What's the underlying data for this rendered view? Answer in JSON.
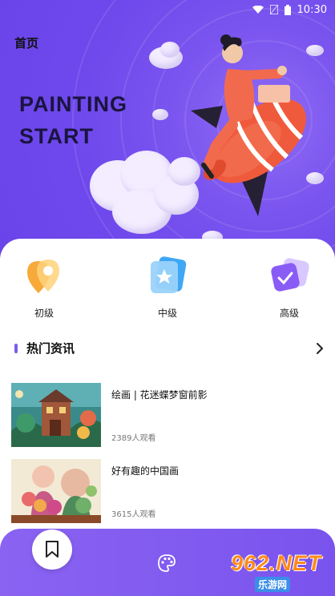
{
  "status_bar": {
    "time": "10:30"
  },
  "header": {
    "title": "首页"
  },
  "hero": {
    "line1": "PAINTING",
    "line2": "START"
  },
  "levels": [
    {
      "label": "初级",
      "icon": "location-pin-icon"
    },
    {
      "label": "中级",
      "icon": "star-cards-icon"
    },
    {
      "label": "高级",
      "icon": "check-cards-icon"
    }
  ],
  "section": {
    "title": "热门资讯",
    "more_icon": "chevron-right-icon"
  },
  "news": [
    {
      "title": "绘画 | 花迷蝶梦窗前影",
      "views": "2389人观看"
    },
    {
      "title": "好有趣的中国画",
      "views": "3615人观看"
    }
  ],
  "tabs": [
    {
      "icon": "bookmark-icon",
      "active": true
    },
    {
      "icon": "palette-icon",
      "active": false
    }
  ],
  "watermark": {
    "big": "962.NET",
    "small": "乐游网"
  },
  "colors": {
    "accent": "#7c5cf0",
    "hero_bg": "#6f49ec",
    "tab_bg": "#8a63f2"
  }
}
